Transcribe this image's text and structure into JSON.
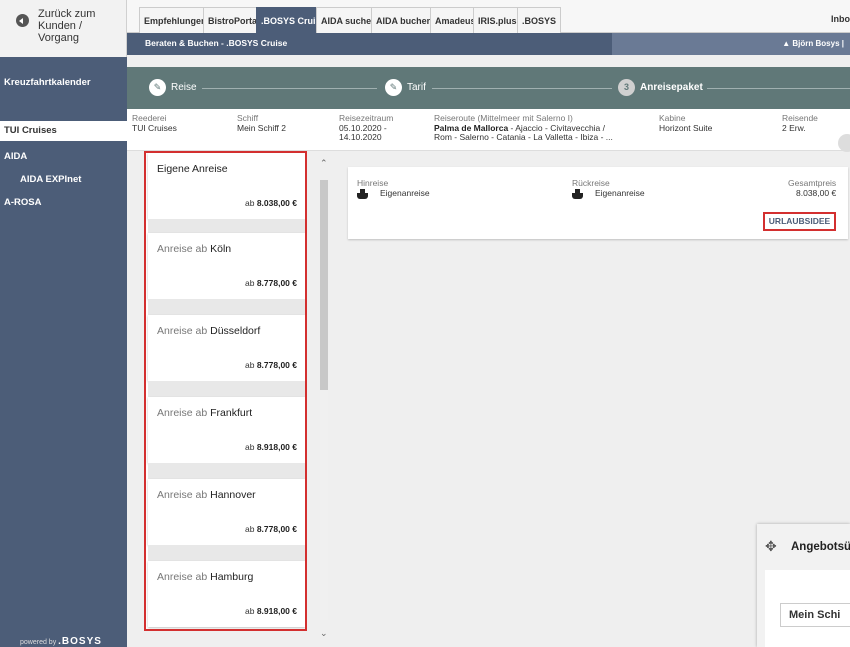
{
  "sidebar": {
    "back_label_1": "Zurück zum",
    "back_label_2": "Kunden / Vorgang",
    "items": [
      {
        "label": "Kreuzfahrtkalender"
      },
      {
        "label": "TUI Cruises"
      },
      {
        "label": "AIDA"
      },
      {
        "label": "AIDA EXPInet"
      },
      {
        "label": "A-ROSA"
      }
    ],
    "powered_prefix": "powered by",
    "powered_brand": ".BOSYS"
  },
  "topnav": {
    "tabs": [
      {
        "label": "Empfehlungen"
      },
      {
        "label": "BistroPortal"
      },
      {
        "label": ".BOSYS Cruise"
      },
      {
        "label": "AIDA suchen"
      },
      {
        "label": "AIDA buchen"
      },
      {
        "label": "Amadeus"
      },
      {
        "label": "IRIS.plus"
      },
      {
        "label": ".BOSYS"
      }
    ],
    "right_label": "Inbo"
  },
  "subnav": {
    "breadcrumb": "Beraten & Buchen  -  .BOSYS Cruise",
    "user": "Björn Bosys"
  },
  "steps": [
    {
      "label": "Reise"
    },
    {
      "label": "Tarif"
    },
    {
      "number": "3",
      "label": "Anreisepaket"
    }
  ],
  "info": {
    "reederei_label": "Reederei",
    "reederei": "TUI Cruises",
    "schiff_label": "Schiff",
    "schiff": "Mein Schiff 2",
    "zeitraum_label": "Reisezeitraum",
    "zeitraum_1": "05.10.2020 -",
    "zeitraum_2": "14.10.2020",
    "route_label": "Reiseroute (Mittelmeer mit Salerno I)",
    "route_bold": "Palma de Mallorca",
    "route_1": " - Ajaccio - Civitavecchia /",
    "route_2": "Rom - Salerno - Catania - La Valletta - Ibiza - ...",
    "kabine_label": "Kabine",
    "kabine": "Horizont Suite",
    "reisende_label": "Reisende",
    "reisende": "2 Erw."
  },
  "offers": [
    {
      "prefix": "",
      "city": "Eigene Anreise",
      "price_prefix": "ab ",
      "price": "8.038,00 €"
    },
    {
      "prefix": "Anreise ab ",
      "city": "Köln",
      "price_prefix": "ab ",
      "price": "8.778,00 €"
    },
    {
      "prefix": "Anreise ab ",
      "city": "Düsseldorf",
      "price_prefix": "ab ",
      "price": "8.778,00 €"
    },
    {
      "prefix": "Anreise ab ",
      "city": "Frankfurt",
      "price_prefix": "ab ",
      "price": "8.918,00 €"
    },
    {
      "prefix": "Anreise ab ",
      "city": "Hannover",
      "price_prefix": "ab ",
      "price": "8.778,00 €"
    },
    {
      "prefix": "Anreise ab ",
      "city": "Hamburg",
      "price_prefix": "ab ",
      "price": "8.918,00 €"
    }
  ],
  "summary": {
    "hin_label": "Hinreise",
    "hin_value": "Eigenanreise",
    "rueck_label": "Rückreise",
    "rueck_value": "Eigenanreise",
    "gesamt_label": "Gesamtpreis",
    "gesamt_value": "8.038,00 €",
    "urlaub_button": "URLAUBSIDEE"
  },
  "modal": {
    "title": "Angebotsü",
    "row": "Mein Schi"
  }
}
